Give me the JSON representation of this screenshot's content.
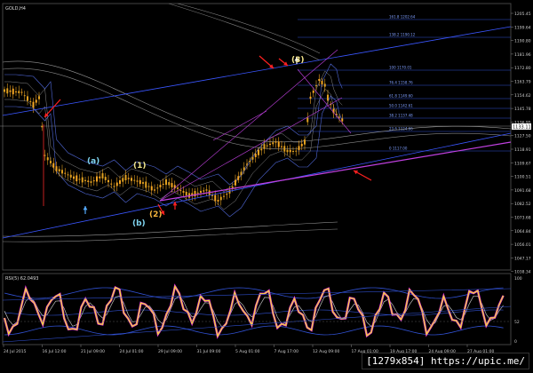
{
  "chart": {
    "symbol_label": "GOLD,H4",
    "last_price": "1133.11",
    "price_axis": [
      "1205.45",
      "1199.64",
      "1190.80",
      "1181.96",
      "1172.80",
      "1163.79",
      "1154.62",
      "1145.78",
      "1136.95",
      "1127.50",
      "1118.91",
      "1109.67",
      "1100.51",
      "1091.68",
      "1082.52",
      "1073.68",
      "1064.84",
      "1056.01",
      "1047.17",
      "1038.34"
    ],
    "fib_levels": [
      {
        "label": "161.8 1202.64"
      },
      {
        "label": "138.2 1190.12"
      },
      {
        "label": "100 1170.01"
      },
      {
        "label": "76.4 1158.76"
      },
      {
        "label": "61.8 1149.60"
      },
      {
        "label": "50.0 1142.61"
      },
      {
        "label": "38.2 1137.48"
      },
      {
        "label": "23.6 1124.66"
      },
      {
        "label": "0 1117.00"
      }
    ],
    "wave_labels": [
      "(a)",
      "(1)",
      "(b)",
      "(2)",
      "(3)"
    ],
    "wave_colors": {
      "(a)": "#7fd4f0",
      "(b)": "#7fd4f0",
      "(1)": "#f0e68c",
      "(2)": "#f5b43c",
      "(3)": "#f5e68c"
    },
    "up_candle_color": "#f5a623",
    "down_candle_color": "#e0a020",
    "channel_color": "#3a56ff",
    "fan_color": "#c040e0",
    "arrow_color": "#ff2020"
  },
  "indicator": {
    "label": "RSI(5) 62.0493",
    "axis": [
      "100",
      "52",
      "0"
    ]
  },
  "time_axis": [
    "24 Jul 2015",
    "16 Jul 12:00",
    "21 Jul 09:00",
    "24 Jul 01:00",
    "29 Jul 09:00",
    "31 Jul 09:00",
    "5 Aug 01:00",
    "7 Aug 17:00",
    "12 Aug 09:00",
    "17 Aug 01:00",
    "19 Aug 17:00",
    "24 Aug 09:00",
    "27 Aug 01:00"
  ],
  "watermark": "[1279x854] https://upic.me/"
}
